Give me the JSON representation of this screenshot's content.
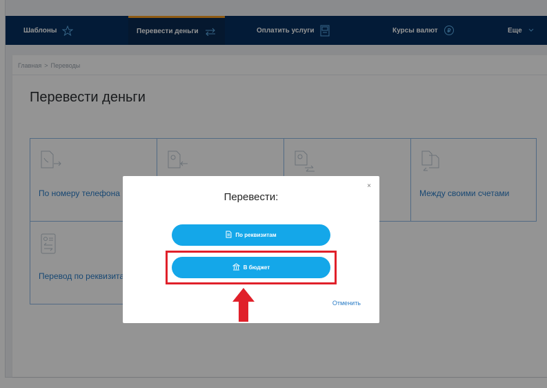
{
  "nav": {
    "items": [
      {
        "label": "Шаблоны",
        "icon": "star-icon"
      },
      {
        "label": "Перевести деньги",
        "icon": "transfer-arrows-icon",
        "active": true
      },
      {
        "label": "Оплатить услуги",
        "icon": "terminal-icon"
      },
      {
        "label": "Курсы валют",
        "icon": "currency-icon"
      },
      {
        "label": "Еще",
        "icon": "chevron-down-icon"
      }
    ],
    "accent": "#f59e23",
    "background": "#063060"
  },
  "breadcrumb": {
    "home": "Главная",
    "separator": ">",
    "current": "Переводы"
  },
  "page": {
    "title": "Перевести деньги"
  },
  "cards": [
    {
      "label": "По номеру телефона",
      "icon": "phone-doc-icon"
    },
    {
      "label": "",
      "icon": "card-doc-icon"
    },
    {
      "label": "",
      "icon": "user-doc-icon"
    },
    {
      "label": "Между своими счетами",
      "icon": "accounts-doc-icon"
    },
    {
      "label": "Перевод по реквизитам",
      "icon": "requisites-doc-icon"
    }
  ],
  "modal": {
    "title": "Перевести:",
    "close": "×",
    "buttons": [
      {
        "label": "По реквизитам",
        "icon": "document-icon"
      },
      {
        "label": "В бюджет",
        "icon": "bank-icon"
      }
    ],
    "cancel": "Отменить",
    "button_color": "#14a7e9"
  },
  "annotation": {
    "highlight_color": "#e0202a"
  }
}
